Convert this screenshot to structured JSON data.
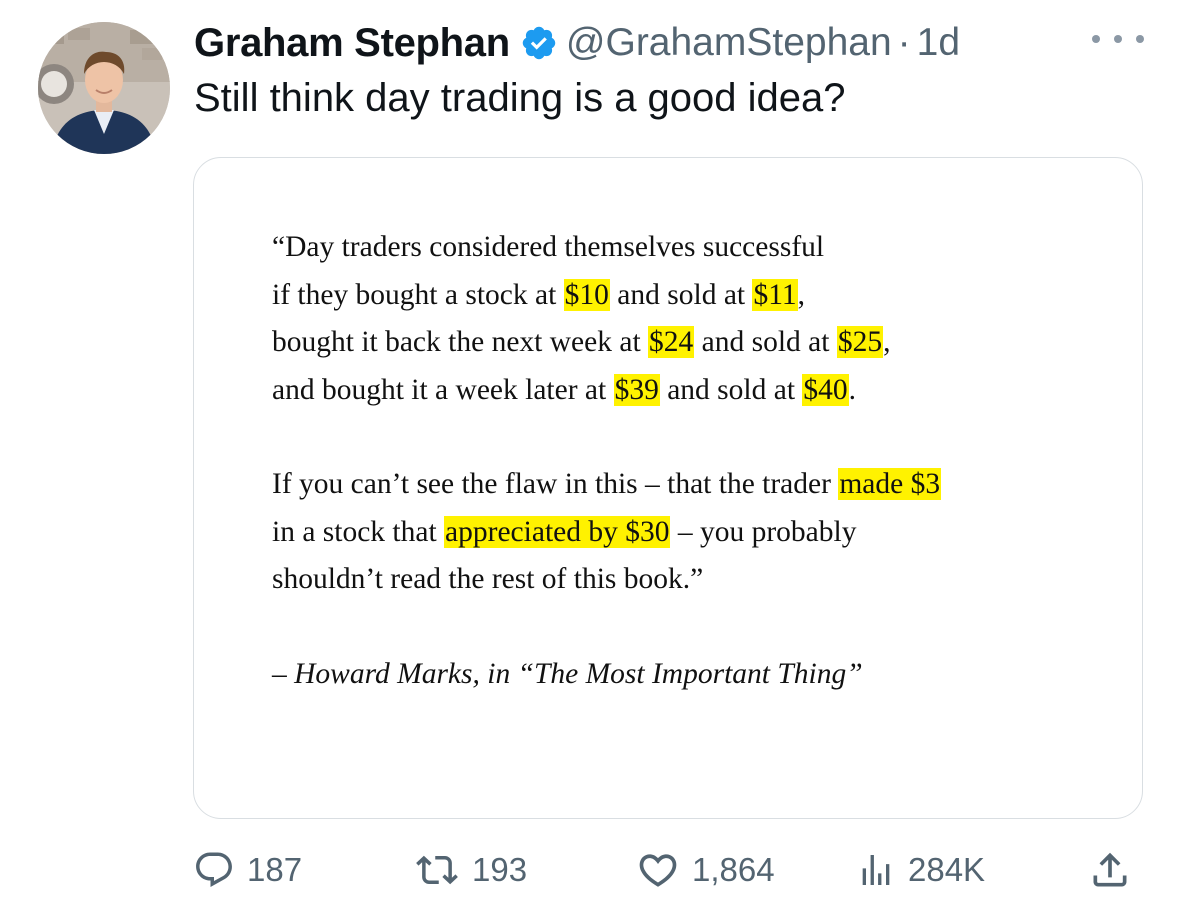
{
  "tweet": {
    "author_name": "Graham Stephan",
    "verified": true,
    "verified_icon": "verified-badge-icon",
    "handle": "@GrahamStephan",
    "separator": "·",
    "time": "1d",
    "text": "Still think day trading is a good idea?"
  },
  "media": {
    "quote": {
      "para1": [
        [
          {
            "t": "“Day traders considered themselves successful",
            "hl": false
          }
        ],
        [
          {
            "t": "if they bought a stock at ",
            "hl": false
          },
          {
            "t": "$10",
            "hl": true
          },
          {
            "t": " and sold at ",
            "hl": false
          },
          {
            "t": "$11",
            "hl": true
          },
          {
            "t": ",",
            "hl": false
          }
        ],
        [
          {
            "t": "bought it back the next week at ",
            "hl": false
          },
          {
            "t": "$24",
            "hl": true
          },
          {
            "t": " and sold at ",
            "hl": false
          },
          {
            "t": "$25",
            "hl": true
          },
          {
            "t": ",",
            "hl": false
          }
        ],
        [
          {
            "t": "and bought it a week later at ",
            "hl": false
          },
          {
            "t": "$39",
            "hl": true
          },
          {
            "t": " and sold at ",
            "hl": false
          },
          {
            "t": "$40",
            "hl": true
          },
          {
            "t": ".",
            "hl": false
          }
        ]
      ],
      "para2": [
        [
          {
            "t": "If you can’t see the flaw in this – that the trader ",
            "hl": false
          },
          {
            "t": "made $3",
            "hl": true
          }
        ],
        [
          {
            "t": "in a stock that ",
            "hl": false
          },
          {
            "t": "appreciated by $30",
            "hl": true
          },
          {
            "t": " – you probably",
            "hl": false
          }
        ],
        [
          {
            "t": "shouldn’t read the rest of this book.”",
            "hl": false
          }
        ]
      ],
      "attribution": "– Howard Marks, in “The Most Important Thing”"
    },
    "highlight_color": "#fff200"
  },
  "actions": {
    "replies": {
      "icon": "reply-icon",
      "count": "187"
    },
    "reposts": {
      "icon": "repost-icon",
      "count": "193"
    },
    "likes": {
      "icon": "like-icon",
      "count": "1,864"
    },
    "views": {
      "icon": "views-icon",
      "count": "284K"
    },
    "share": {
      "icon": "share-icon"
    }
  },
  "colors": {
    "verified_blue": "#1d9bf0",
    "secondary_text": "#536471",
    "primary_text": "#0f1419"
  }
}
